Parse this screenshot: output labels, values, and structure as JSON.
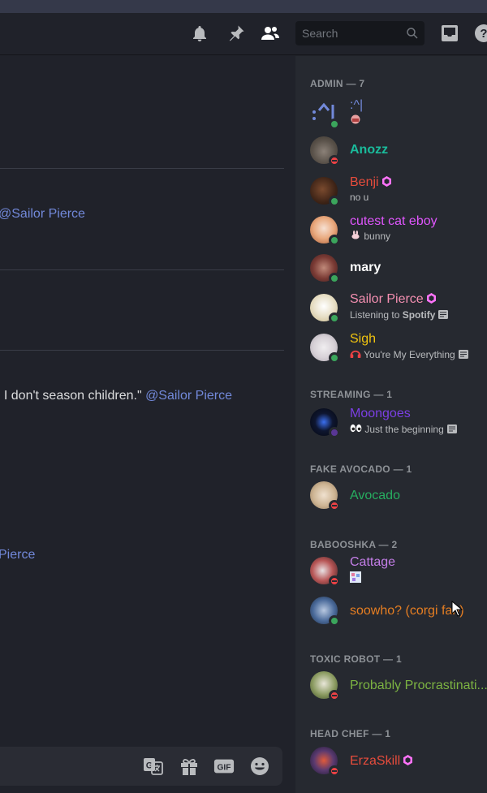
{
  "toolbar": {
    "search_placeholder": "Search",
    "icons": [
      "bell-icon",
      "pin-icon",
      "members-icon",
      "search-icon",
      "inbox-icon",
      "help-icon"
    ]
  },
  "chat": {
    "line1": {
      "mention": "@Sailor Pierce"
    },
    "line2": {
      "text": ". I don't season children.\" ",
      "mention": "@Sailor Pierce"
    },
    "line3": {
      "mention": "Pierce"
    },
    "composer_icons": [
      "translate-icon",
      "gift-icon",
      "gif-icon",
      "emoji-icon"
    ],
    "gif_label": "GIF"
  },
  "members": {
    "sections": [
      {
        "title": "ADMIN — 7"
      },
      {
        "title": "STREAMING — 1"
      },
      {
        "title": "FAKE AVOCADO — 1"
      },
      {
        "title": "BABOOSHKA — 2"
      },
      {
        "title": "TOXIC ROBOT — 1"
      },
      {
        "title": "HEAD CHEF — 1"
      }
    ],
    "list": [
      {
        "name": ":^|",
        "sub": "",
        "color": "#7289da",
        "status": "online"
      },
      {
        "name": "Anozz",
        "sub": "",
        "color": "#1abc9c",
        "status": "dnd"
      },
      {
        "name": "Benji",
        "sub": "no u",
        "color": "#e74c3c",
        "status": "online",
        "boost": true
      },
      {
        "name": "cutest cat eboy",
        "sub": "bunny",
        "color": "#e056fd",
        "status": "online"
      },
      {
        "name": "mary",
        "sub": "",
        "color": "#ffffff",
        "status": "online"
      },
      {
        "name": "Sailor Pierce",
        "sub_prefix": "Listening to ",
        "sub_bold": "Spotify",
        "color": "#f48fb1",
        "status": "online",
        "boost": true
      },
      {
        "name": "Sigh",
        "sub": "You're My Everything",
        "color": "#f1c40f",
        "status": "online"
      },
      {
        "name": "Moongoes",
        "sub": "Just the beginning",
        "color": "#7b3fe4",
        "status": "streaming"
      },
      {
        "name": "Avocado",
        "sub": "",
        "color": "#27ae60",
        "status": "dnd"
      },
      {
        "name": "Cattage",
        "sub": "",
        "color": "#c47ee8",
        "status": "dnd"
      },
      {
        "name": "soowho? (corgi fan)",
        "sub": "",
        "color": "#e67e22",
        "status": "online"
      },
      {
        "name": "Probably Procrastinati...",
        "sub": "",
        "color": "#7cb342",
        "status": "dnd"
      },
      {
        "name": "ErzaSkill",
        "sub": "",
        "color": "#e74c3c",
        "status": "dnd",
        "boost": true
      }
    ]
  },
  "colors": {
    "mention": "#7289da",
    "online": "#3ba55c",
    "dnd": "#ed4245",
    "streaming": "#593695",
    "boost": "#ff73fa"
  }
}
